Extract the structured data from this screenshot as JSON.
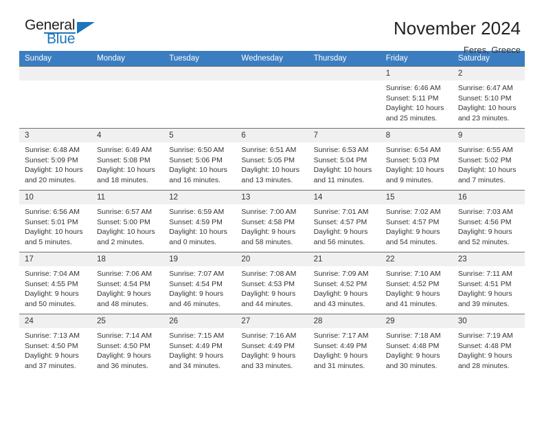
{
  "brand": {
    "name_part1": "General",
    "name_part2": "Blue",
    "accent_color": "#1b75bb"
  },
  "header": {
    "month_title": "November 2024",
    "location": "Feres, Greece"
  },
  "calendar": {
    "header_bg": "#3b7dc1",
    "daynum_bg": "#f0f0f0",
    "weekdays": [
      "Sunday",
      "Monday",
      "Tuesday",
      "Wednesday",
      "Thursday",
      "Friday",
      "Saturday"
    ],
    "weeks": [
      [
        {
          "day": "",
          "sunrise": "",
          "sunset": "",
          "daylight": "",
          "empty": true
        },
        {
          "day": "",
          "sunrise": "",
          "sunset": "",
          "daylight": "",
          "empty": true
        },
        {
          "day": "",
          "sunrise": "",
          "sunset": "",
          "daylight": "",
          "empty": true
        },
        {
          "day": "",
          "sunrise": "",
          "sunset": "",
          "daylight": "",
          "empty": true
        },
        {
          "day": "",
          "sunrise": "",
          "sunset": "",
          "daylight": "",
          "empty": true
        },
        {
          "day": "1",
          "sunrise": "Sunrise: 6:46 AM",
          "sunset": "Sunset: 5:11 PM",
          "daylight": "Daylight: 10 hours and 25 minutes.",
          "empty": false
        },
        {
          "day": "2",
          "sunrise": "Sunrise: 6:47 AM",
          "sunset": "Sunset: 5:10 PM",
          "daylight": "Daylight: 10 hours and 23 minutes.",
          "empty": false
        }
      ],
      [
        {
          "day": "3",
          "sunrise": "Sunrise: 6:48 AM",
          "sunset": "Sunset: 5:09 PM",
          "daylight": "Daylight: 10 hours and 20 minutes.",
          "empty": false
        },
        {
          "day": "4",
          "sunrise": "Sunrise: 6:49 AM",
          "sunset": "Sunset: 5:08 PM",
          "daylight": "Daylight: 10 hours and 18 minutes.",
          "empty": false
        },
        {
          "day": "5",
          "sunrise": "Sunrise: 6:50 AM",
          "sunset": "Sunset: 5:06 PM",
          "daylight": "Daylight: 10 hours and 16 minutes.",
          "empty": false
        },
        {
          "day": "6",
          "sunrise": "Sunrise: 6:51 AM",
          "sunset": "Sunset: 5:05 PM",
          "daylight": "Daylight: 10 hours and 13 minutes.",
          "empty": false
        },
        {
          "day": "7",
          "sunrise": "Sunrise: 6:53 AM",
          "sunset": "Sunset: 5:04 PM",
          "daylight": "Daylight: 10 hours and 11 minutes.",
          "empty": false
        },
        {
          "day": "8",
          "sunrise": "Sunrise: 6:54 AM",
          "sunset": "Sunset: 5:03 PM",
          "daylight": "Daylight: 10 hours and 9 minutes.",
          "empty": false
        },
        {
          "day": "9",
          "sunrise": "Sunrise: 6:55 AM",
          "sunset": "Sunset: 5:02 PM",
          "daylight": "Daylight: 10 hours and 7 minutes.",
          "empty": false
        }
      ],
      [
        {
          "day": "10",
          "sunrise": "Sunrise: 6:56 AM",
          "sunset": "Sunset: 5:01 PM",
          "daylight": "Daylight: 10 hours and 5 minutes.",
          "empty": false
        },
        {
          "day": "11",
          "sunrise": "Sunrise: 6:57 AM",
          "sunset": "Sunset: 5:00 PM",
          "daylight": "Daylight: 10 hours and 2 minutes.",
          "empty": false
        },
        {
          "day": "12",
          "sunrise": "Sunrise: 6:59 AM",
          "sunset": "Sunset: 4:59 PM",
          "daylight": "Daylight: 10 hours and 0 minutes.",
          "empty": false
        },
        {
          "day": "13",
          "sunrise": "Sunrise: 7:00 AM",
          "sunset": "Sunset: 4:58 PM",
          "daylight": "Daylight: 9 hours and 58 minutes.",
          "empty": false
        },
        {
          "day": "14",
          "sunrise": "Sunrise: 7:01 AM",
          "sunset": "Sunset: 4:57 PM",
          "daylight": "Daylight: 9 hours and 56 minutes.",
          "empty": false
        },
        {
          "day": "15",
          "sunrise": "Sunrise: 7:02 AM",
          "sunset": "Sunset: 4:57 PM",
          "daylight": "Daylight: 9 hours and 54 minutes.",
          "empty": false
        },
        {
          "day": "16",
          "sunrise": "Sunrise: 7:03 AM",
          "sunset": "Sunset: 4:56 PM",
          "daylight": "Daylight: 9 hours and 52 minutes.",
          "empty": false
        }
      ],
      [
        {
          "day": "17",
          "sunrise": "Sunrise: 7:04 AM",
          "sunset": "Sunset: 4:55 PM",
          "daylight": "Daylight: 9 hours and 50 minutes.",
          "empty": false
        },
        {
          "day": "18",
          "sunrise": "Sunrise: 7:06 AM",
          "sunset": "Sunset: 4:54 PM",
          "daylight": "Daylight: 9 hours and 48 minutes.",
          "empty": false
        },
        {
          "day": "19",
          "sunrise": "Sunrise: 7:07 AM",
          "sunset": "Sunset: 4:54 PM",
          "daylight": "Daylight: 9 hours and 46 minutes.",
          "empty": false
        },
        {
          "day": "20",
          "sunrise": "Sunrise: 7:08 AM",
          "sunset": "Sunset: 4:53 PM",
          "daylight": "Daylight: 9 hours and 44 minutes.",
          "empty": false
        },
        {
          "day": "21",
          "sunrise": "Sunrise: 7:09 AM",
          "sunset": "Sunset: 4:52 PM",
          "daylight": "Daylight: 9 hours and 43 minutes.",
          "empty": false
        },
        {
          "day": "22",
          "sunrise": "Sunrise: 7:10 AM",
          "sunset": "Sunset: 4:52 PM",
          "daylight": "Daylight: 9 hours and 41 minutes.",
          "empty": false
        },
        {
          "day": "23",
          "sunrise": "Sunrise: 7:11 AM",
          "sunset": "Sunset: 4:51 PM",
          "daylight": "Daylight: 9 hours and 39 minutes.",
          "empty": false
        }
      ],
      [
        {
          "day": "24",
          "sunrise": "Sunrise: 7:13 AM",
          "sunset": "Sunset: 4:50 PM",
          "daylight": "Daylight: 9 hours and 37 minutes.",
          "empty": false
        },
        {
          "day": "25",
          "sunrise": "Sunrise: 7:14 AM",
          "sunset": "Sunset: 4:50 PM",
          "daylight": "Daylight: 9 hours and 36 minutes.",
          "empty": false
        },
        {
          "day": "26",
          "sunrise": "Sunrise: 7:15 AM",
          "sunset": "Sunset: 4:49 PM",
          "daylight": "Daylight: 9 hours and 34 minutes.",
          "empty": false
        },
        {
          "day": "27",
          "sunrise": "Sunrise: 7:16 AM",
          "sunset": "Sunset: 4:49 PM",
          "daylight": "Daylight: 9 hours and 33 minutes.",
          "empty": false
        },
        {
          "day": "28",
          "sunrise": "Sunrise: 7:17 AM",
          "sunset": "Sunset: 4:49 PM",
          "daylight": "Daylight: 9 hours and 31 minutes.",
          "empty": false
        },
        {
          "day": "29",
          "sunrise": "Sunrise: 7:18 AM",
          "sunset": "Sunset: 4:48 PM",
          "daylight": "Daylight: 9 hours and 30 minutes.",
          "empty": false
        },
        {
          "day": "30",
          "sunrise": "Sunrise: 7:19 AM",
          "sunset": "Sunset: 4:48 PM",
          "daylight": "Daylight: 9 hours and 28 minutes.",
          "empty": false
        }
      ]
    ]
  }
}
